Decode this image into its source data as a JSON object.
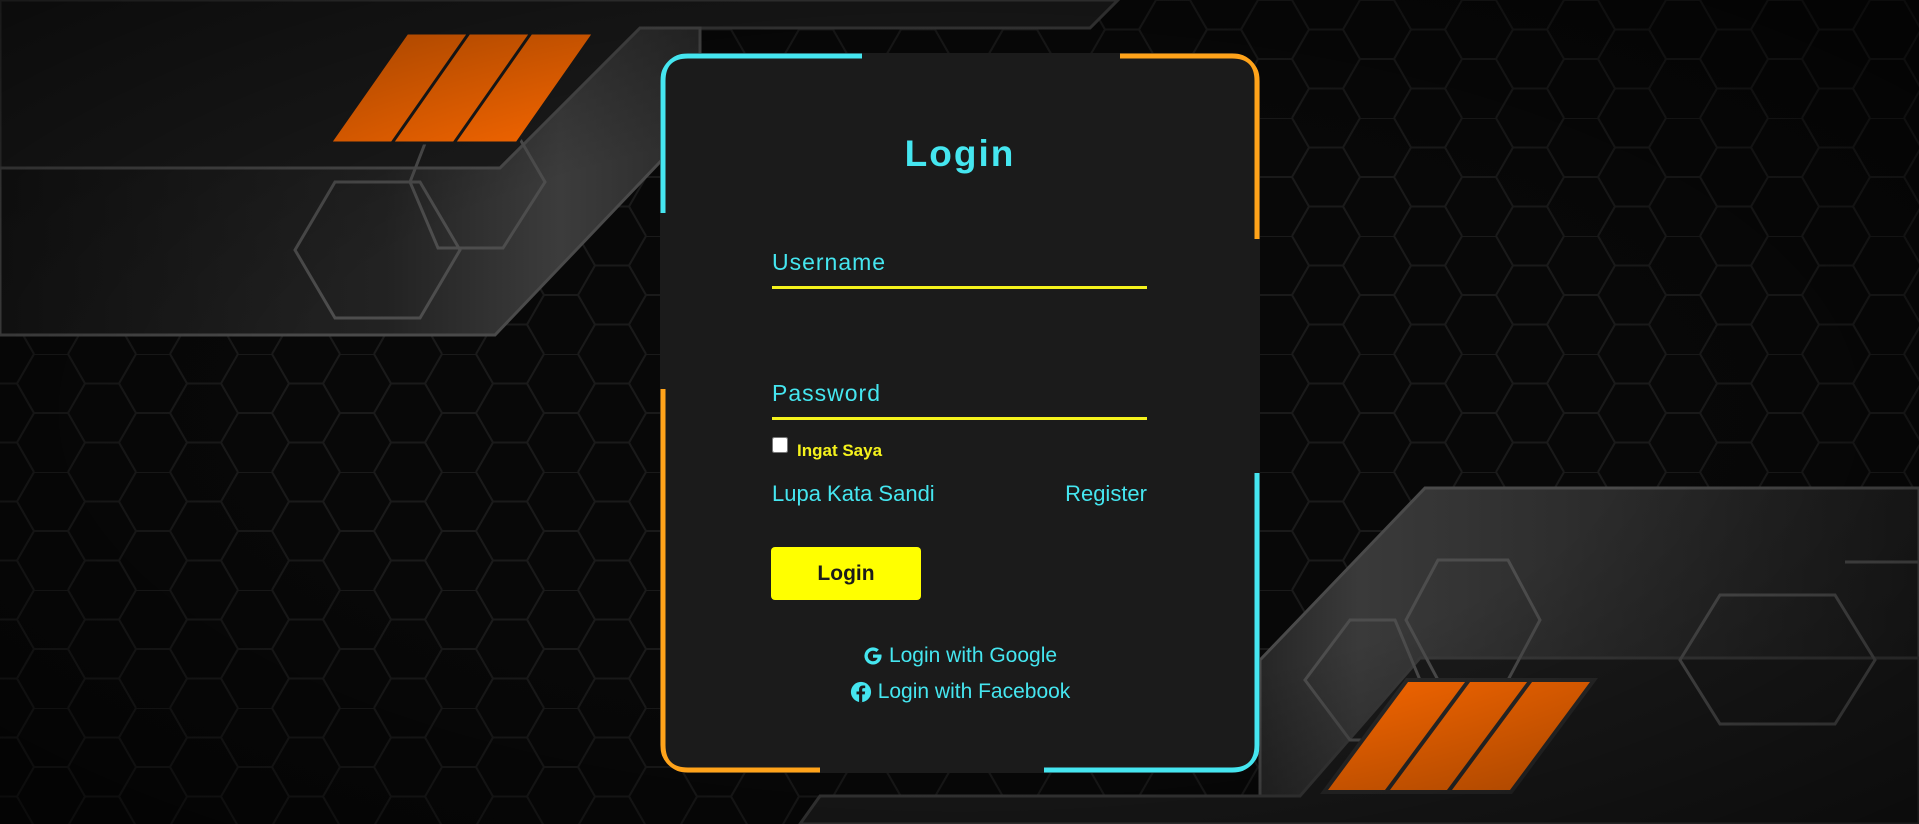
{
  "form": {
    "title": "Login",
    "username_label": "Username",
    "password_label": "Password",
    "remember_label": "Ingat Saya",
    "forgot_link": "Lupa Kata Sandi",
    "register_link": "Register",
    "login_button": "Login",
    "google_login": "Login with Google",
    "facebook_login": "Login with Facebook"
  },
  "colors": {
    "cyan_accent": "#45e6f0",
    "yellow_accent": "#f5f21c",
    "button_yellow": "#ffff00",
    "orange_accent": "#ffa31a",
    "stripe_orange": "#ff6a00",
    "card_bg": "#1b1b1b",
    "page_bg": "#070707"
  },
  "icons": {
    "google": "google-icon",
    "facebook": "facebook-icon"
  }
}
